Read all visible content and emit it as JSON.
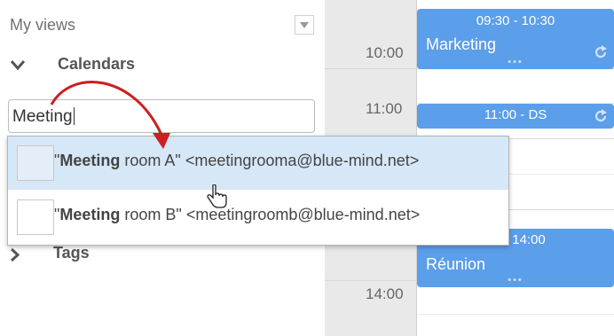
{
  "sidebar": {
    "my_views_label": "My views",
    "calendars_label": "Calendars",
    "search_value": "Meeting",
    "tags_label": "Tags"
  },
  "autocomplete": {
    "options": [
      {
        "quote_open": "\"",
        "match": "Meeting",
        "rest": " room A\" <meetingrooma@blue-mind.net>",
        "highlighted": true
      },
      {
        "quote_open": "\"",
        "match": "Meeting",
        "rest": " room B\" <meetingroomb@blue-mind.net>",
        "highlighted": false
      }
    ]
  },
  "calendar": {
    "times": {
      "t1000": "10:00",
      "t1100": "11:00",
      "t1400": "14:00"
    },
    "events": {
      "marketing": {
        "time": "09:30 - 10:30",
        "title": "Marketing"
      },
      "ds": {
        "time": "11:00 - DS"
      },
      "reunion": {
        "time": "00 - 14:00",
        "title": "Réunion"
      }
    }
  },
  "colors": {
    "event": "#5b9ee9",
    "highlight": "#d6e7f7",
    "arrow": "#cc1f1f"
  }
}
